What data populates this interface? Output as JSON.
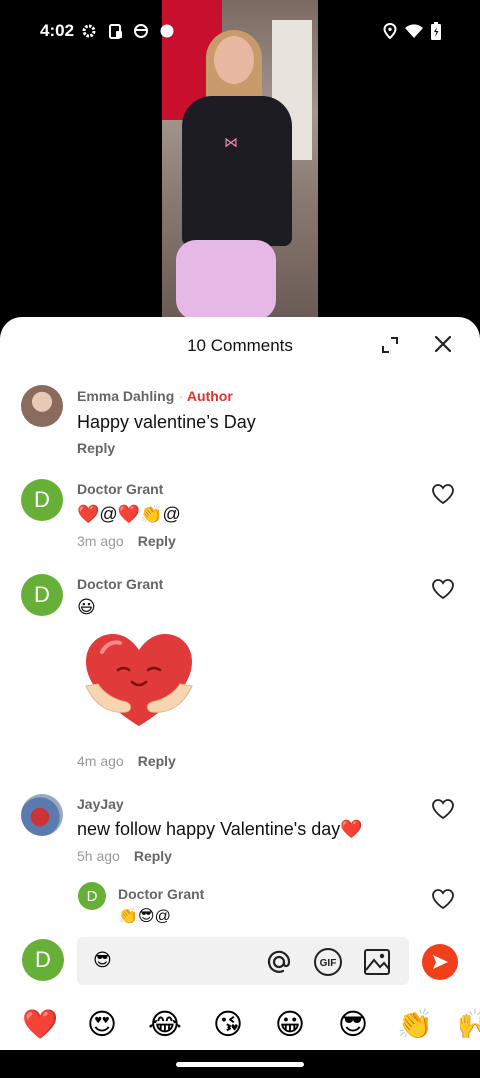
{
  "status_bar": {
    "time": "4:02",
    "left_icons": [
      "gear-icon",
      "clipboard-icon",
      "shield-icon",
      "dot-icon"
    ],
    "right_icons": [
      "location-icon",
      "wifi-icon",
      "battery-icon"
    ]
  },
  "sheet": {
    "title": "10 Comments"
  },
  "comments": [
    {
      "author": "Emma Dahling",
      "tag": "Author",
      "text": "Happy valentine’s Day",
      "time": "",
      "reply_label": "Reply"
    },
    {
      "author": "Doctor Grant",
      "avatar_letter": "D",
      "text": "❤️@❤️👏@",
      "time": "3m ago",
      "reply_label": "Reply"
    },
    {
      "author": "Doctor Grant",
      "avatar_letter": "D",
      "text": "😃",
      "sticker": "heart-hug-sticker",
      "time": "4m ago",
      "reply_label": "Reply"
    },
    {
      "author": "JayJay",
      "text": "new follow happy Valentine's day❤️",
      "time": "5h ago",
      "reply_label": "Reply"
    },
    {
      "author": "Doctor Grant",
      "avatar_letter": "D",
      "text": "👏😎@",
      "is_reply": true
    }
  ],
  "composer": {
    "avatar_letter": "D",
    "value": "😎",
    "gif_label": "GIF"
  },
  "emoji_bar": [
    "❤️",
    "😍",
    "😂",
    "😘",
    "😀",
    "😎",
    "👏",
    "🙌"
  ],
  "colors": {
    "accent": "#f03f1a",
    "author_tag": "#e0332d",
    "avatar_green": "#66b037"
  }
}
